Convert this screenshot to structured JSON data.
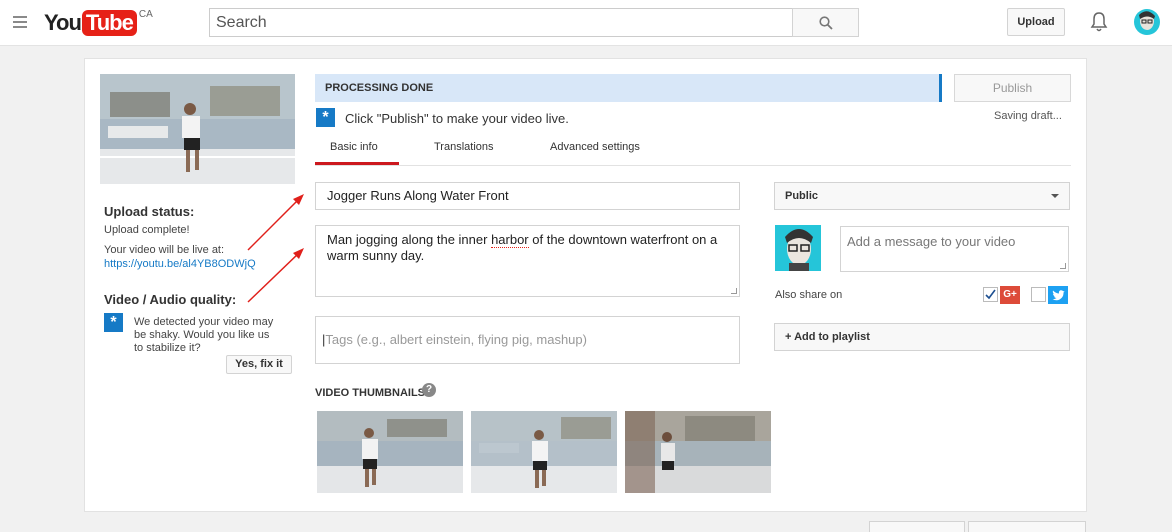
{
  "header": {
    "logo_you": "You",
    "logo_tube": "Tube",
    "logo_region": "CA",
    "search_placeholder": "Search",
    "upload_label": "Upload"
  },
  "sidebar": {
    "upload_status_heading": "Upload status:",
    "upload_complete": "Upload complete!",
    "live_at": "Your video will be live at:",
    "video_link": "https://youtu.be/al4YB8ODWjQ",
    "quality_heading": "Video / Audio quality:",
    "shaky_line1": "We detected your video may",
    "shaky_line2": "be shaky. Would you like us",
    "shaky_line3": "to stabilize it?",
    "fix_button": "Yes, fix it"
  },
  "status": {
    "processing": "PROCESSING DONE",
    "publish_button": "Publish",
    "publish_message": "Click \"Publish\" to make your video live.",
    "saving": "Saving draft..."
  },
  "tabs": [
    "Basic info",
    "Translations",
    "Advanced settings"
  ],
  "form": {
    "title": "Jogger Runs Along Water Front",
    "description_line1_pre": "Man jogging along the inner ",
    "description_line1_spell": "harbor",
    "description_line1_post": " of the downtown waterfront on a",
    "description_line2": "warm sunny day.",
    "tags_placeholder": "Tags (e.g., albert einstein, flying pig, mashup)",
    "thumbnails_label": "VIDEO THUMBNAILS",
    "help_glyph": "?"
  },
  "right": {
    "privacy": "Public",
    "message_placeholder": "Add a message to your video",
    "also_share": "Also share on",
    "gplus": "G+",
    "add_playlist": "+ Add to playlist"
  },
  "colors": {
    "brand_red": "#e62117",
    "link_blue": "#167ac6",
    "processing_bg": "#d8e7f8",
    "tab_active": "#cc181e"
  },
  "icons": [
    "hamburger-icon",
    "search-icon",
    "bell-icon",
    "star-info-icon",
    "help-icon",
    "caret-down-icon",
    "checkbox-icon",
    "google-plus-icon",
    "twitter-icon"
  ]
}
